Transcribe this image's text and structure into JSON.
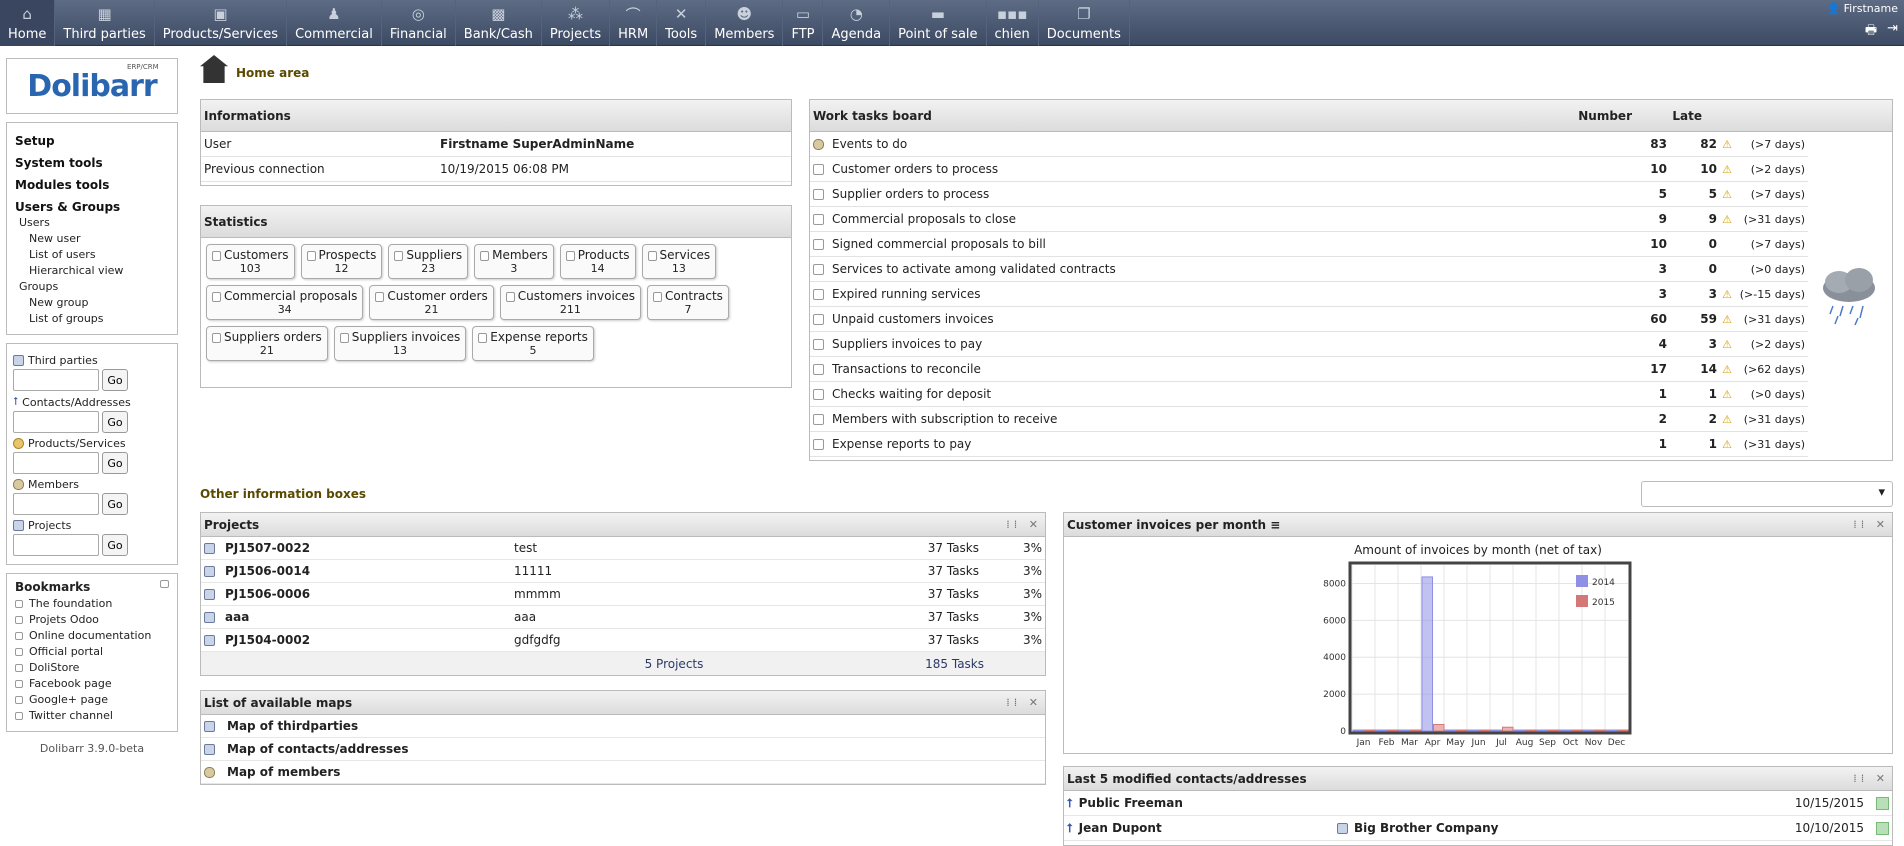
{
  "topmenu": [
    {
      "label": "Home",
      "icon": "home-icon"
    },
    {
      "label": "Third parties",
      "icon": "building-icon"
    },
    {
      "label": "Products/Services",
      "icon": "boxes-icon"
    },
    {
      "label": "Commercial",
      "icon": "commercial-icon"
    },
    {
      "label": "Financial",
      "icon": "coins-icon"
    },
    {
      "label": "Bank/Cash",
      "icon": "safe-icon"
    },
    {
      "label": "Projects",
      "icon": "projects-icon"
    },
    {
      "label": "HRM",
      "icon": "hrm-icon"
    },
    {
      "label": "Tools",
      "icon": "tools-icon"
    },
    {
      "label": "Members",
      "icon": "members-icon"
    },
    {
      "label": "FTP",
      "icon": "ftp-icon"
    },
    {
      "label": "Agenda",
      "icon": "agenda-icon"
    },
    {
      "label": "Point of sale",
      "icon": "pos-icon"
    },
    {
      "label": "chien",
      "icon": "chien-icon"
    },
    {
      "label": "Documents",
      "icon": "documents-icon"
    }
  ],
  "user": {
    "name": "Firstname"
  },
  "logo": {
    "text": "Dolibarr",
    "sub": "ERP/CRM"
  },
  "leftmenu": {
    "setup": "Setup",
    "system_tools": "System tools",
    "modules_tools": "Modules tools",
    "users_groups": "Users & Groups",
    "users": "Users",
    "new_user": "New user",
    "list_users": "List of users",
    "hier": "Hierarchical view",
    "groups": "Groups",
    "new_group": "New group",
    "list_groups": "List of groups"
  },
  "search": {
    "third": "Third parties",
    "contacts": "Contacts/Addresses",
    "products": "Products/Services",
    "members": "Members",
    "projects": "Projects",
    "go": "Go"
  },
  "bookmarks": {
    "title": "Bookmarks",
    "items": [
      "The foundation",
      "Projets Odoo",
      "Online documentation",
      "Official portal",
      "DoliStore",
      "Facebook page",
      "Google+ page",
      "Twitter channel"
    ]
  },
  "version": "Dolibarr 3.9.0-beta",
  "page_title": "Home area",
  "info": {
    "title": "Informations",
    "user_label": "User",
    "user_value": "Firstname SuperAdminName",
    "prev_label": "Previous connection",
    "prev_value": "10/19/2015 06:08 PM"
  },
  "stats": {
    "title": "Statistics",
    "items": [
      {
        "label": "Customers",
        "n": "103"
      },
      {
        "label": "Prospects",
        "n": "12"
      },
      {
        "label": "Suppliers",
        "n": "23"
      },
      {
        "label": "Members",
        "n": "3"
      },
      {
        "label": "Products",
        "n": "14"
      },
      {
        "label": "Services",
        "n": "13"
      },
      {
        "label": "Commercial proposals",
        "n": "34"
      },
      {
        "label": "Customer orders",
        "n": "21"
      },
      {
        "label": "Customers invoices",
        "n": "211"
      },
      {
        "label": "Contracts",
        "n": "7"
      },
      {
        "label": "Suppliers orders",
        "n": "21"
      },
      {
        "label": "Suppliers invoices",
        "n": "13"
      },
      {
        "label": "Expense reports",
        "n": "5"
      }
    ]
  },
  "board": {
    "title": "Work tasks board",
    "col_number": "Number",
    "col_late": "Late",
    "rows": [
      {
        "label": "Events to do",
        "n": "83",
        "late": "82",
        "warn": true,
        "days": "(>7 days)"
      },
      {
        "label": "Customer orders to process",
        "n": "10",
        "late": "10",
        "warn": true,
        "days": "(>2 days)"
      },
      {
        "label": "Supplier orders to process",
        "n": "5",
        "late": "5",
        "warn": true,
        "days": "(>7 days)"
      },
      {
        "label": "Commercial proposals to close",
        "n": "9",
        "late": "9",
        "warn": true,
        "days": "(>31 days)"
      },
      {
        "label": "Signed commercial proposals to bill",
        "n": "10",
        "late": "0",
        "warn": false,
        "days": "(>7 days)"
      },
      {
        "label": "Services to activate among validated contracts",
        "n": "3",
        "late": "0",
        "warn": false,
        "days": "(>0 days)"
      },
      {
        "label": "Expired running services",
        "n": "3",
        "late": "3",
        "warn": true,
        "days": "(>-15 days)"
      },
      {
        "label": "Unpaid customers invoices",
        "n": "60",
        "late": "59",
        "warn": true,
        "days": "(>31 days)"
      },
      {
        "label": "Suppliers invoices to pay",
        "n": "4",
        "late": "3",
        "warn": true,
        "days": "(>2 days)"
      },
      {
        "label": "Transactions to reconcile",
        "n": "17",
        "late": "14",
        "warn": true,
        "days": "(>62 days)"
      },
      {
        "label": "Checks waiting for deposit",
        "n": "1",
        "late": "1",
        "warn": true,
        "days": "(>0 days)"
      },
      {
        "label": "Members with subscription to receive",
        "n": "2",
        "late": "2",
        "warn": true,
        "days": "(>31 days)"
      },
      {
        "label": "Expense reports to pay",
        "n": "1",
        "late": "1",
        "warn": true,
        "days": "(>31 days)"
      }
    ]
  },
  "other_boxes": "Other information boxes",
  "projects": {
    "title": "Projects",
    "rows": [
      {
        "ref": "PJ1507-0022",
        "name": "test",
        "tasks": "37 Tasks",
        "pct": "3%"
      },
      {
        "ref": "PJ1506-0014",
        "name": "11111",
        "tasks": "37 Tasks",
        "pct": "3%"
      },
      {
        "ref": "PJ1506-0006",
        "name": "mmmm",
        "tasks": "37 Tasks",
        "pct": "3%"
      },
      {
        "ref": "aaa",
        "name": "aaa",
        "tasks": "37 Tasks",
        "pct": "3%"
      },
      {
        "ref": "PJ1504-0002",
        "name": "gdfgdfg",
        "tasks": "37 Tasks",
        "pct": "3%"
      }
    ],
    "total_projects": "5 Projects",
    "total_tasks": "185 Tasks"
  },
  "maps": {
    "title": "List of available maps",
    "rows": [
      "Map of thirdparties",
      "Map of contacts/addresses",
      "Map of members"
    ]
  },
  "chart_box_title": "Customer invoices per month",
  "chart_data": {
    "type": "bar",
    "title": "Amount of invoices by month (net of tax)",
    "categories": [
      "Jan",
      "Feb",
      "Mar",
      "Apr",
      "May",
      "Jun",
      "Jul",
      "Aug",
      "Sep",
      "Oct",
      "Nov",
      "Dec"
    ],
    "series": [
      {
        "name": "2014",
        "color": "#8f8fe6",
        "values": [
          0,
          0,
          0,
          8300,
          0,
          0,
          0,
          0,
          0,
          0,
          0,
          0
        ]
      },
      {
        "name": "2015",
        "color": "#d67777",
        "values": [
          0,
          0,
          0,
          300,
          0,
          0,
          150,
          0,
          0,
          0,
          0,
          0
        ]
      }
    ],
    "yticks": [
      0,
      2000,
      4000,
      6000,
      8000
    ],
    "ylim": [
      0,
      9000
    ],
    "legend": "top-right"
  },
  "contacts": {
    "title": "Last 5 modified contacts/addresses",
    "rows": [
      {
        "name": "Public Freeman",
        "company": "",
        "date": "10/15/2015"
      },
      {
        "name": "Jean Dupont",
        "company": "Big Brother Company",
        "date": "10/10/2015"
      }
    ]
  }
}
